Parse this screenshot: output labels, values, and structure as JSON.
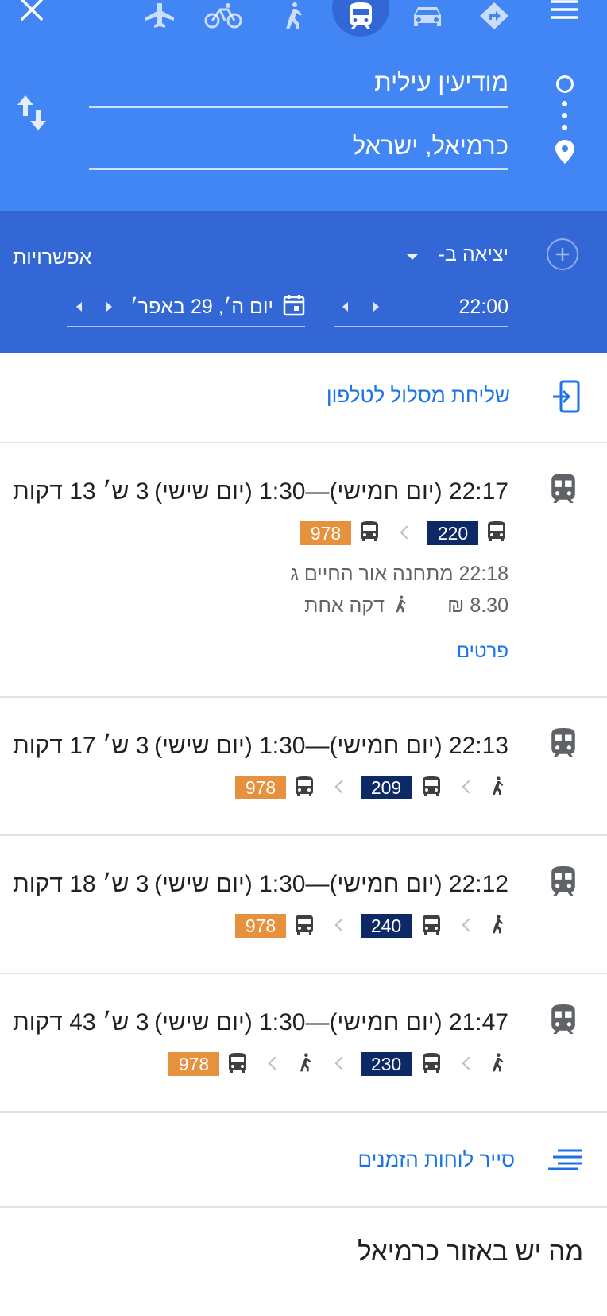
{
  "header": {
    "origin": "מודיעין עילית",
    "destination": "כרמיאל, ישראל",
    "modes": [
      "flight",
      "bicycle",
      "walking",
      "transit",
      "car",
      "directions"
    ],
    "selected_mode": "transit"
  },
  "options": {
    "depart_label": "יציאה ב-",
    "options_label": "אפשרויות",
    "time": "22:00",
    "date": "יום ה׳, 29 באפר׳"
  },
  "send_to_phone": "שליחת מסלול לטלפון",
  "routes": [
    {
      "times": "22:17 (יום חמישי)—1:30 (יום שישי)",
      "duration": "3 ש׳ 13 דקות",
      "legs": [
        "bus 220",
        "bus 978"
      ],
      "first_leg_bus": "220",
      "second_leg_bus": "978",
      "departure_info": "22:18 מתחנה אור החיים ג",
      "fare": "8.30 ₪",
      "walk": "דקה אחת",
      "details": "פרטים"
    },
    {
      "times": "22:13 (יום חמישי)—1:30 (יום שישי)",
      "duration": "3 ש׳ 17 דקות",
      "first_leg_bus": "209",
      "second_leg_bus": "978"
    },
    {
      "times": "22:12 (יום חמישי)—1:30 (יום שישי)",
      "duration": "3 ש׳ 18 דקות",
      "first_leg_bus": "240",
      "second_leg_bus": "978"
    },
    {
      "times": "21:47 (יום חמישי)—1:30 (יום שישי)",
      "duration": "3 ש׳ 43 דקות",
      "first_leg_bus": "230",
      "second_leg_bus": "978"
    }
  ],
  "schedule_explorer": "סייר לוחות הזמנים",
  "nearby_title": "מה יש באזור כרמיאל",
  "colors": {
    "header_blue": "#4285f4",
    "options_blue": "#3367d6",
    "navy_chip": "#0d2a66",
    "orange_chip": "#e6913d",
    "link_blue": "#1a73e8"
  }
}
